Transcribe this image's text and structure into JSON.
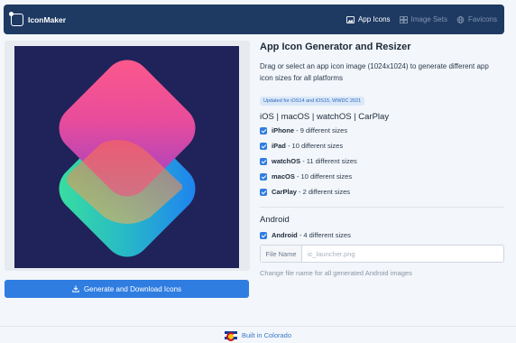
{
  "navbar": {
    "brand": "IconMaker",
    "items": [
      {
        "label": "App Icons",
        "icon": "image-icon",
        "active": true
      },
      {
        "label": "Image Sets",
        "icon": "grid-icon",
        "active": false
      },
      {
        "label": "Favicons",
        "icon": "globe-icon",
        "active": false
      }
    ]
  },
  "colors": {
    "nav_bg": "#1e3a63",
    "accent": "#2f7de1",
    "preview_bg": "#20225a"
  },
  "preview": {
    "image": "Shortcuts app icon preview"
  },
  "generate_button": {
    "label": "Generate and Download Icons",
    "icon": "download-icon"
  },
  "panel": {
    "title": "App Icon Generator and Resizer",
    "description": "Drag or select an app icon image (1024x1024) to generate different app icon sizes for all platforms",
    "badge": "Updated for iOS14 and iOS15, WWDC 2021",
    "apple_heading": "iOS | macOS | watchOS | CarPlay",
    "apple_options": [
      {
        "name": "iPhone",
        "detail": "- 9 different sizes",
        "checked": true
      },
      {
        "name": "iPad",
        "detail": "- 10 different sizes",
        "checked": true
      },
      {
        "name": "watchOS",
        "detail": "- 11 different sizes",
        "checked": true
      },
      {
        "name": "macOS",
        "detail": "- 10 different sizes",
        "checked": true
      },
      {
        "name": "CarPlay",
        "detail": "- 2 different sizes",
        "checked": true
      }
    ],
    "android_heading": "Android",
    "android_option": {
      "name": "Android",
      "detail": "- 4 different sizes",
      "checked": true
    },
    "file_name_label": "File Name",
    "file_name_placeholder": "ic_launcher.png",
    "file_name_value": "",
    "help_text": "Change file name for all generated Android images"
  },
  "footer": {
    "text": "Built in Colorado",
    "icon": "colorado-flag-icon"
  }
}
